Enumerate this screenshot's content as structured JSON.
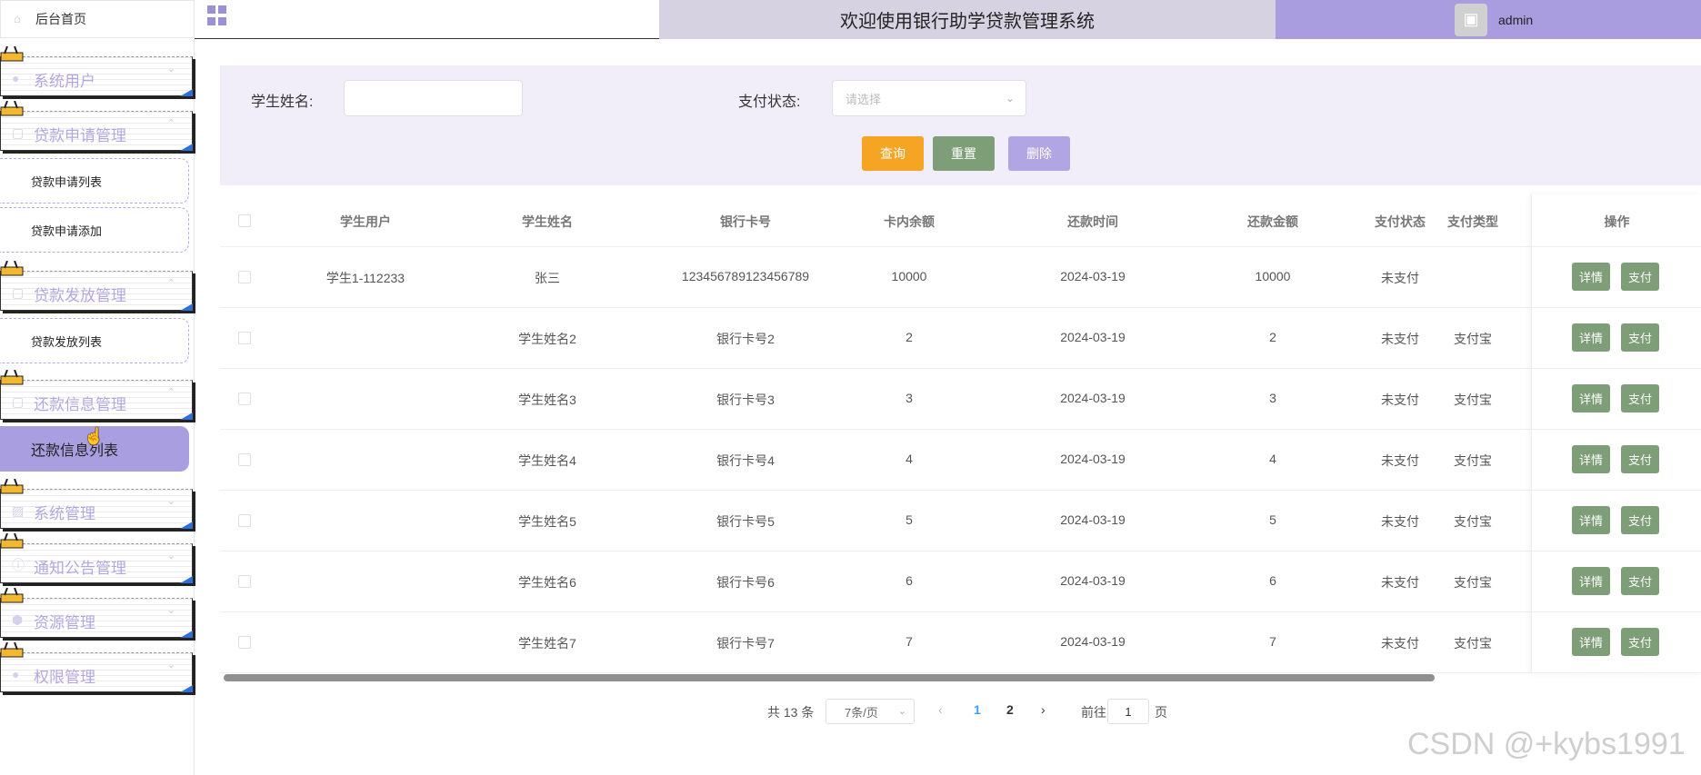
{
  "sidebar": {
    "home": "后台首页",
    "groups": [
      {
        "label": "系统用户",
        "icon": "user-icon"
      },
      {
        "label": "贷款申请管理",
        "icon": "doc-icon"
      },
      {
        "label": "贷款发放管理",
        "icon": "doc-icon"
      },
      {
        "label": "还款信息管理",
        "icon": "doc-icon"
      },
      {
        "label": "系统管理",
        "icon": "image-icon"
      },
      {
        "label": "通知公告管理",
        "icon": "info-icon"
      },
      {
        "label": "资源管理",
        "icon": "shield-icon"
      },
      {
        "label": "权限管理",
        "icon": "user-icon"
      }
    ],
    "subs": {
      "loan_apply_list": "贷款申请列表",
      "loan_apply_add": "贷款申请添加",
      "loan_issue_list": "贷款发放列表",
      "repay_list": "还款信息列表"
    }
  },
  "header": {
    "title": "欢迎使用银行助学贷款管理系统",
    "user": "admin"
  },
  "filter": {
    "name_label": "学生姓名:",
    "name_value": "",
    "status_label": "支付状态:",
    "status_placeholder": "请选择",
    "query": "查询",
    "reset": "重置",
    "delete": "删除"
  },
  "table": {
    "headers": [
      "学生用户",
      "学生姓名",
      "银行卡号",
      "卡内余额",
      "还款时间",
      "还款金额",
      "支付状态",
      "支付类型",
      "操作"
    ],
    "rows": [
      [
        "学生1-112233",
        "张三",
        "123456789123456789",
        "10000",
        "2024-03-19",
        "10000",
        "未支付",
        ""
      ],
      [
        "",
        "学生姓名2",
        "银行卡号2",
        "2",
        "2024-03-19",
        "2",
        "未支付",
        "支付宝"
      ],
      [
        "",
        "学生姓名3",
        "银行卡号3",
        "3",
        "2024-03-19",
        "3",
        "未支付",
        "支付宝"
      ],
      [
        "",
        "学生姓名4",
        "银行卡号4",
        "4",
        "2024-03-19",
        "4",
        "未支付",
        "支付宝"
      ],
      [
        "",
        "学生姓名5",
        "银行卡号5",
        "5",
        "2024-03-19",
        "5",
        "未支付",
        "支付宝"
      ],
      [
        "",
        "学生姓名6",
        "银行卡号6",
        "6",
        "2024-03-19",
        "6",
        "未支付",
        "支付宝"
      ],
      [
        "",
        "学生姓名7",
        "银行卡号7",
        "7",
        "2024-03-19",
        "7",
        "未支付",
        "支付宝"
      ]
    ],
    "detail": "详情",
    "pay": "支付"
  },
  "pager": {
    "total": "共 13 条",
    "size": "7条/页",
    "pages": [
      "1",
      "2"
    ],
    "goto_prefix": "前往",
    "goto_value": "1",
    "goto_suffix": "页"
  },
  "watermark": "CSDN @+kybs1991",
  "colors": {
    "accent": "#a99de0",
    "green": "#7d9e76",
    "orange": "#f5a523",
    "lilac": "#b2a5e3"
  }
}
